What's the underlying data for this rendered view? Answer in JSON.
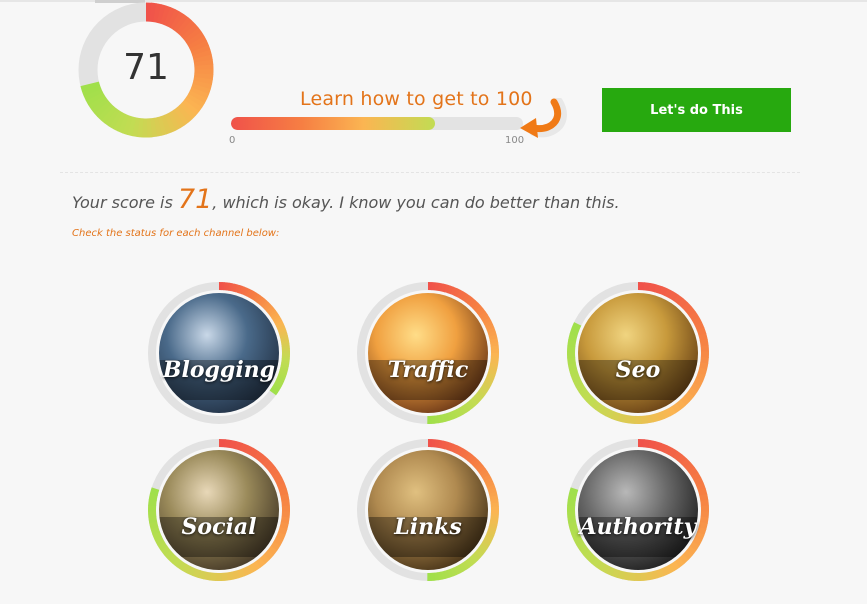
{
  "score": {
    "value": "71",
    "fraction": 0.71
  },
  "progress": {
    "title": "Learn how to get to 100",
    "min_label": "0",
    "max_label": "100",
    "fill_percent": 70
  },
  "cta": {
    "label": "Let's do This"
  },
  "summary": {
    "prefix": "Your score is ",
    "score": "71",
    "suffix": ", which is okay. I know you can do better than this.",
    "hint": "Check the status for each channel below:"
  },
  "channels": [
    {
      "label": "Blogging",
      "fraction": 0.35,
      "theme": "blue",
      "icon": "typewriter-photo"
    },
    {
      "label": "Traffic",
      "fraction": 0.5,
      "theme": "orange",
      "icon": "traffic-photo"
    },
    {
      "label": "Seo",
      "fraction": 0.82,
      "theme": "gold",
      "icon": "compass-photo"
    },
    {
      "label": "Social",
      "fraction": 0.8,
      "theme": "olive",
      "icon": "people-photo"
    },
    {
      "label": "Links",
      "fraction": 0.5,
      "theme": "bronze",
      "icon": "gears-photo"
    },
    {
      "label": "Authority",
      "fraction": 0.8,
      "theme": "dark",
      "icon": "gavel-photo"
    }
  ],
  "colors": {
    "accent": "#e3741a",
    "cta_green": "#27a90f",
    "ring_track": "#e2e2e2",
    "gradient": [
      "#f0524a",
      "#f67f43",
      "#fbb552",
      "#c2dc53",
      "#9ee04a"
    ]
  }
}
